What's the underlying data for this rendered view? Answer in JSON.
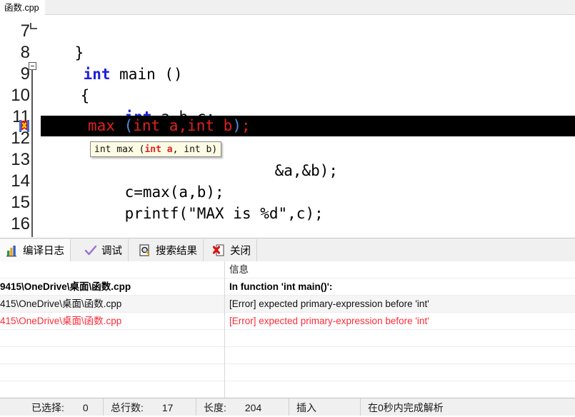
{
  "editor": {
    "tab": {
      "label": "函数.cpp"
    },
    "lines": [
      {
        "number": "7",
        "text": "}"
      },
      {
        "number": "8",
        "text": "int main ()"
      },
      {
        "number": "9",
        "text": "{"
      },
      {
        "number": "10",
        "text": "int a,b,c;"
      },
      {
        "number": "11",
        "text": "max (int a,int b);"
      },
      {
        "number": "12",
        "text": "&a,&b);"
      },
      {
        "number": "13",
        "text": "c=max(a,b);"
      },
      {
        "number": "14",
        "text": "printf(\"MAX is %d\",c);"
      },
      {
        "number": "15",
        "text": ""
      },
      {
        "number": "16",
        "text": ""
      }
    ],
    "highlighted_line": {
      "number": "11",
      "prefix": "max ",
      "open_paren": "(",
      "params": "int a,int b",
      "close_paren": ")",
      "suffix": ";"
    },
    "tooltip": {
      "pre": "int max (",
      "bold": "int a",
      "post": ", int b)"
    },
    "marker_icon": "error-bookmark-icon"
  },
  "panel": {
    "tabs": [
      {
        "label": "编译日志",
        "icon": "bar-chart-icon",
        "active": true
      },
      {
        "label": "调试",
        "icon": "check-mark-icon",
        "active": false
      },
      {
        "label": "搜索结果",
        "icon": "magnifier-icon",
        "active": false
      },
      {
        "label": "关闭",
        "icon": "close-document-icon",
        "active": false
      }
    ],
    "columns": {
      "file": "",
      "message": "信息"
    },
    "rows": [
      {
        "file": "9415\\OneDrive\\桌面\\函数.cpp",
        "message": "In function 'int main()':",
        "style": "bold"
      },
      {
        "file": "415\\OneDrive\\桌面\\函数.cpp",
        "message": "[Error] expected primary-expression before 'int'",
        "style": "normal"
      },
      {
        "file": "415\\OneDrive\\桌面\\函数.cpp",
        "message": "[Error] expected primary-expression before 'int'",
        "style": "error"
      }
    ]
  },
  "statusbar": {
    "selected_label": "已选择:",
    "selected_value": "0",
    "lines_label": "总行数:",
    "lines_value": "17",
    "length_label": "长度:",
    "length_value": "204",
    "mode": "插入",
    "parse_status": "在0秒内完成解析"
  },
  "colors": {
    "keyword": "#2020dd",
    "error_red": "#fc2c38",
    "highlight_bg": "#000000",
    "tooltip_bg": "#fdfbe3"
  }
}
